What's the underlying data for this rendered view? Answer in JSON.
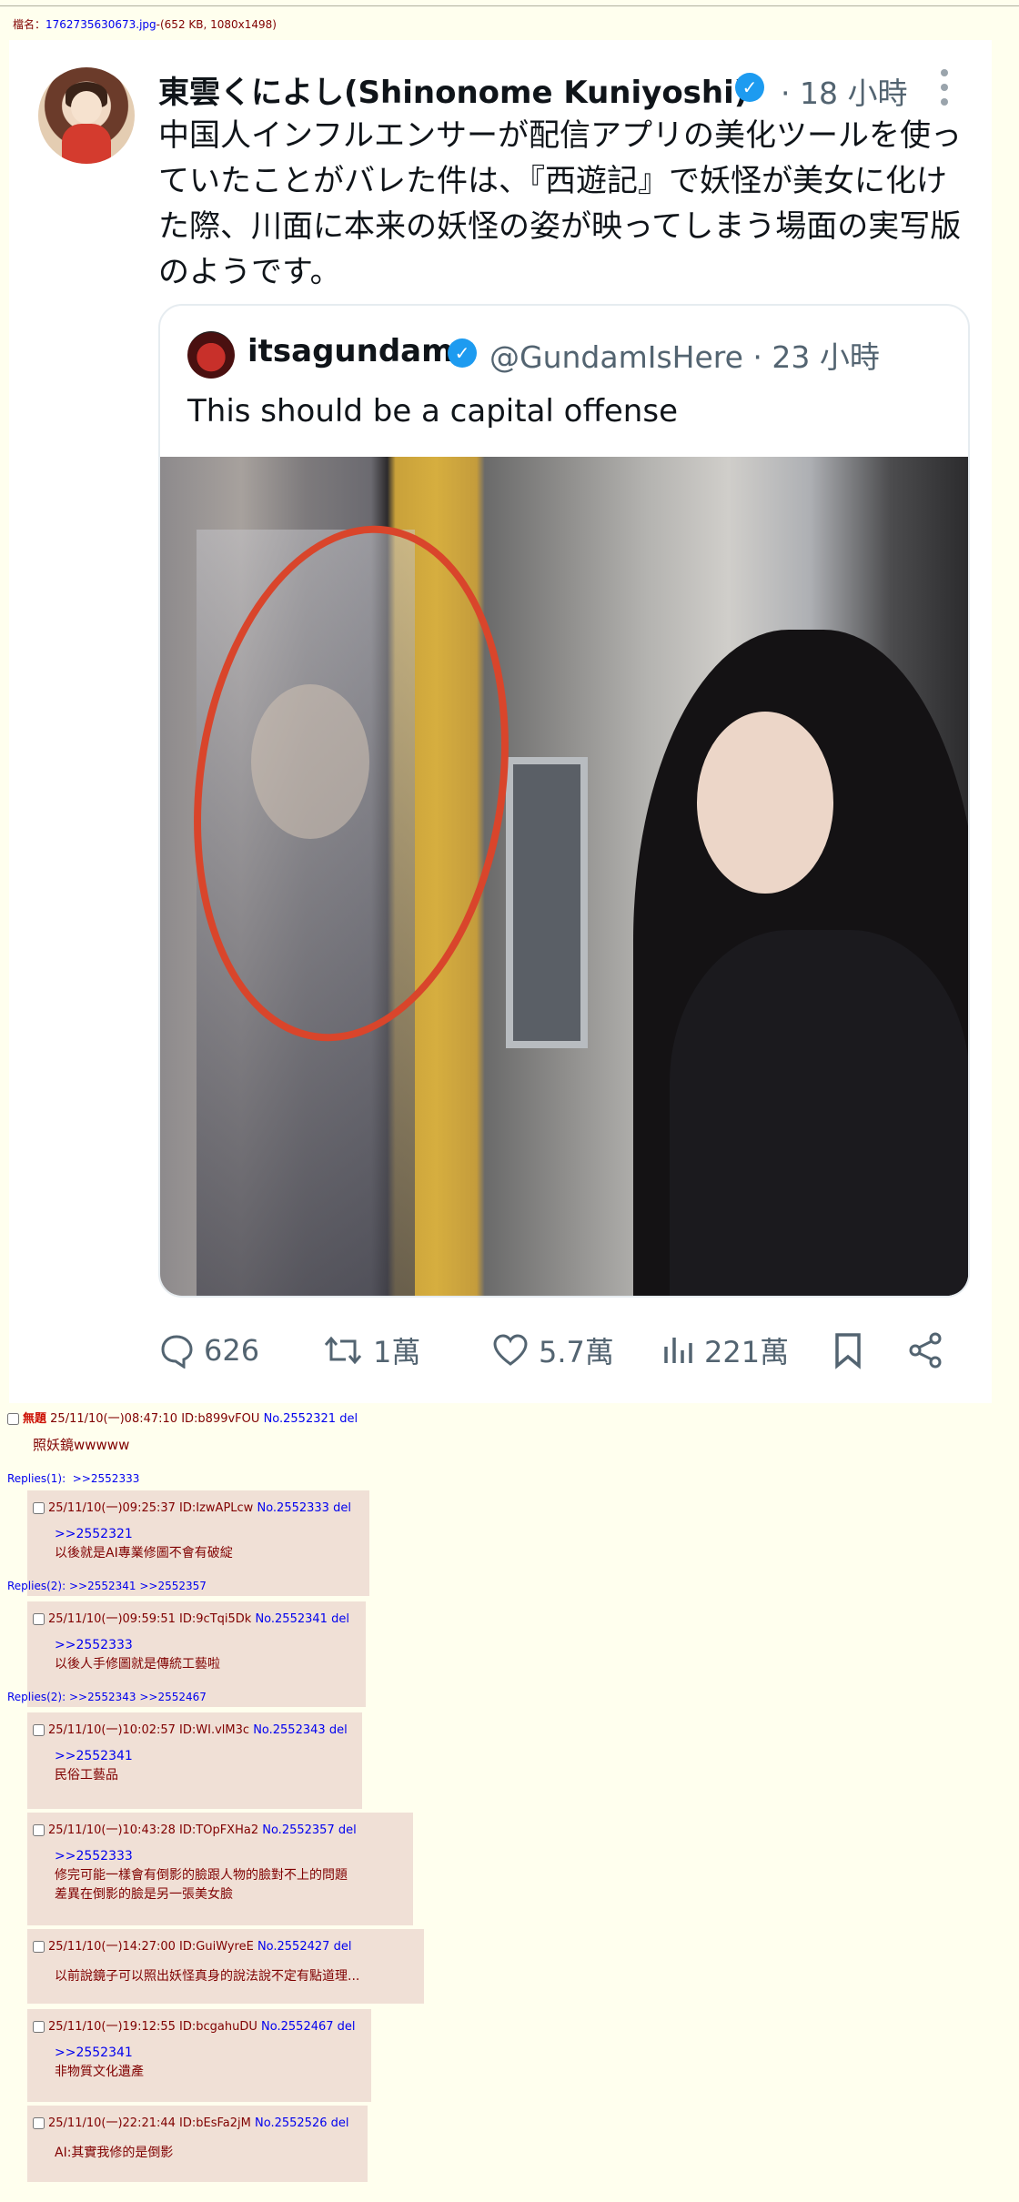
{
  "file_info": {
    "label": "檔名：",
    "filename": "1762735630673.jpg",
    "size": "-(652 KB, 1080x1498)"
  },
  "tweet": {
    "author": "東雲くによし(Shinonome Kuniyoshi)",
    "time": "· 18 小時",
    "text": "中国人インフルエンサーが配信アプリの美化ツールを使っていたことがバレた件は、『西遊記』で妖怪が美女に化けた際、川面に本来の妖怪の姿が映ってしまう場面の実写版のようです。",
    "quoted": {
      "name": "itsagundam",
      "handle": "@GundamIsHere · 23 小時",
      "text": "This should be a capital offense"
    },
    "actions": {
      "replies": "626",
      "retweets": "1萬",
      "likes": "5.7萬",
      "views": "221萬"
    },
    "verified_color": "#1d9bf0"
  },
  "op": {
    "title": "無題",
    "meta": "25/11/10(一)08:47:10 ID:b899vFOU",
    "no": "No.2552321",
    "del": "del",
    "body": "照妖鏡wwwww",
    "replies_label": "Replies(1):",
    "replies": ">>2552333"
  },
  "replies": [
    {
      "meta": "25/11/10(一)09:25:37 ID:IzwAPLcw",
      "no": "No.2552333",
      "del": "del",
      "quote": ">>2552321",
      "lines": [
        "以後就是AI專業修圖不會有破綻"
      ],
      "replies_label": "Replies(2):",
      "replies": ">>2552341 >>2552357"
    },
    {
      "meta": "25/11/10(一)09:59:51 ID:9cTqi5Dk",
      "no": "No.2552341",
      "del": "del",
      "quote": ">>2552333",
      "lines": [
        "以後人手修圖就是傳統工藝啦"
      ],
      "replies_label": "Replies(2):",
      "replies": ">>2552343 >>2552467"
    },
    {
      "meta": "25/11/10(一)10:02:57 ID:WI.vlM3c",
      "no": "No.2552343",
      "del": "del",
      "quote": ">>2552341",
      "lines": [
        "民俗工藝品"
      ]
    },
    {
      "meta": "25/11/10(一)10:43:28 ID:TOpFXHa2",
      "no": "No.2552357",
      "del": "del",
      "quote": ">>2552333",
      "lines": [
        "修完可能一樣會有倒影的臉跟人物的臉對不上的問題",
        "差異在倒影的臉是另一張美女臉"
      ]
    },
    {
      "meta": "25/11/10(一)14:27:00 ID:GuiWyreE",
      "no": "No.2552427",
      "del": "del",
      "quote": "",
      "lines": [
        "以前說鏡子可以照出妖怪真身的說法說不定有點道理..."
      ]
    },
    {
      "meta": "25/11/10(一)19:12:55 ID:bcgahuDU",
      "no": "No.2552467",
      "del": "del",
      "quote": ">>2552341",
      "lines": [
        "非物質文化遺產"
      ]
    },
    {
      "meta": "25/11/10(一)22:21:44 ID:bEsFa2jM",
      "no": "No.2552526",
      "del": "del",
      "quote": "",
      "lines": [
        "AI:其實我修的是倒影"
      ]
    }
  ]
}
